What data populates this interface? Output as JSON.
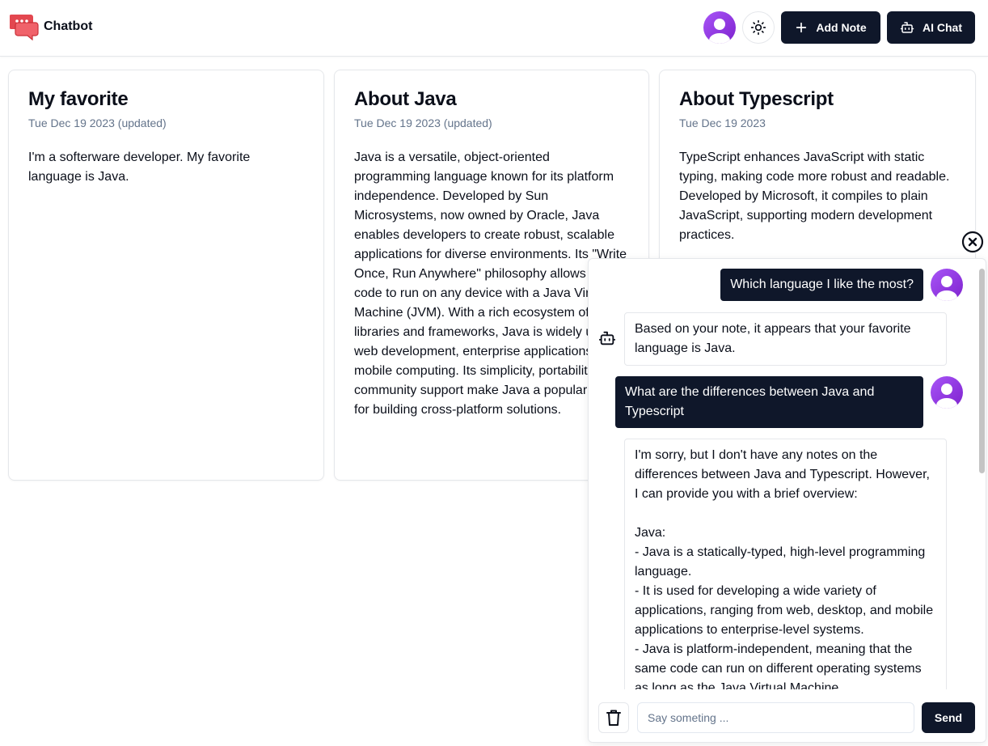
{
  "header": {
    "brand_name": "Chatbot",
    "add_note_label": "Add Note",
    "ai_chat_label": "AI Chat"
  },
  "notes": [
    {
      "title": "My favorite",
      "date": "Tue Dec 19 2023 (updated)",
      "body": "I'm a softerware developer. My favorite language is Java."
    },
    {
      "title": "About Java",
      "date": "Tue Dec 19 2023 (updated)",
      "body": "Java is a versatile, object-oriented programming language known for its platform independence. Developed by Sun Microsystems, now owned by Oracle, Java enables developers to create robust, scalable applications for diverse environments. Its \"Write Once, Run Anywhere\" philosophy allows Java code to run on any device with a Java Virtual Machine (JVM). With a rich ecosystem of libraries and frameworks, Java is widely used in web development, enterprise applications, and mobile computing. Its simplicity, portability, and community support make Java a popular choice for building cross-platform solutions."
    },
    {
      "title": "About Typescript",
      "date": "Tue Dec 19 2023",
      "body": "TypeScript enhances JavaScript with static typing, making code more robust and readable. Developed by Microsoft, it compiles to plain JavaScript, supporting modern development practices."
    }
  ],
  "chat": {
    "messages": [
      {
        "role": "user",
        "text": "Which language I like the most?"
      },
      {
        "role": "bot",
        "text": "Based on your note, it appears that your favorite language is Java."
      },
      {
        "role": "user",
        "text": "What are the differences between Java and Typescript"
      },
      {
        "role": "bot",
        "text": "I'm sorry, but I don't have any notes on the differences between Java and Typescript. However, I can provide you with a brief overview:\n\nJava:\n- Java is a statically-typed, high-level programming language.\n- It is used for developing a wide variety of applications, ranging from web, desktop, and mobile applications to enterprise-level systems.\n- Java is platform-independent, meaning that the same code can run on different operating systems as long as the Java Virtual Machine"
      }
    ],
    "input_placeholder": "Say someting ...",
    "input_value": "",
    "send_label": "Send"
  },
  "icons": {
    "brand": "chat-bubbles-icon",
    "avatar": "user-avatar-icon",
    "theme": "sun-icon",
    "add": "plus-icon",
    "ai_chat": "bot-icon",
    "close": "close-circle-icon",
    "clear": "trash-icon"
  },
  "colors": {
    "primary_dark": "#0f172a",
    "avatar_purple": "#9333ea",
    "brand_red": "#e3474f",
    "muted_text": "#64748b",
    "border": "#e5e7eb"
  }
}
